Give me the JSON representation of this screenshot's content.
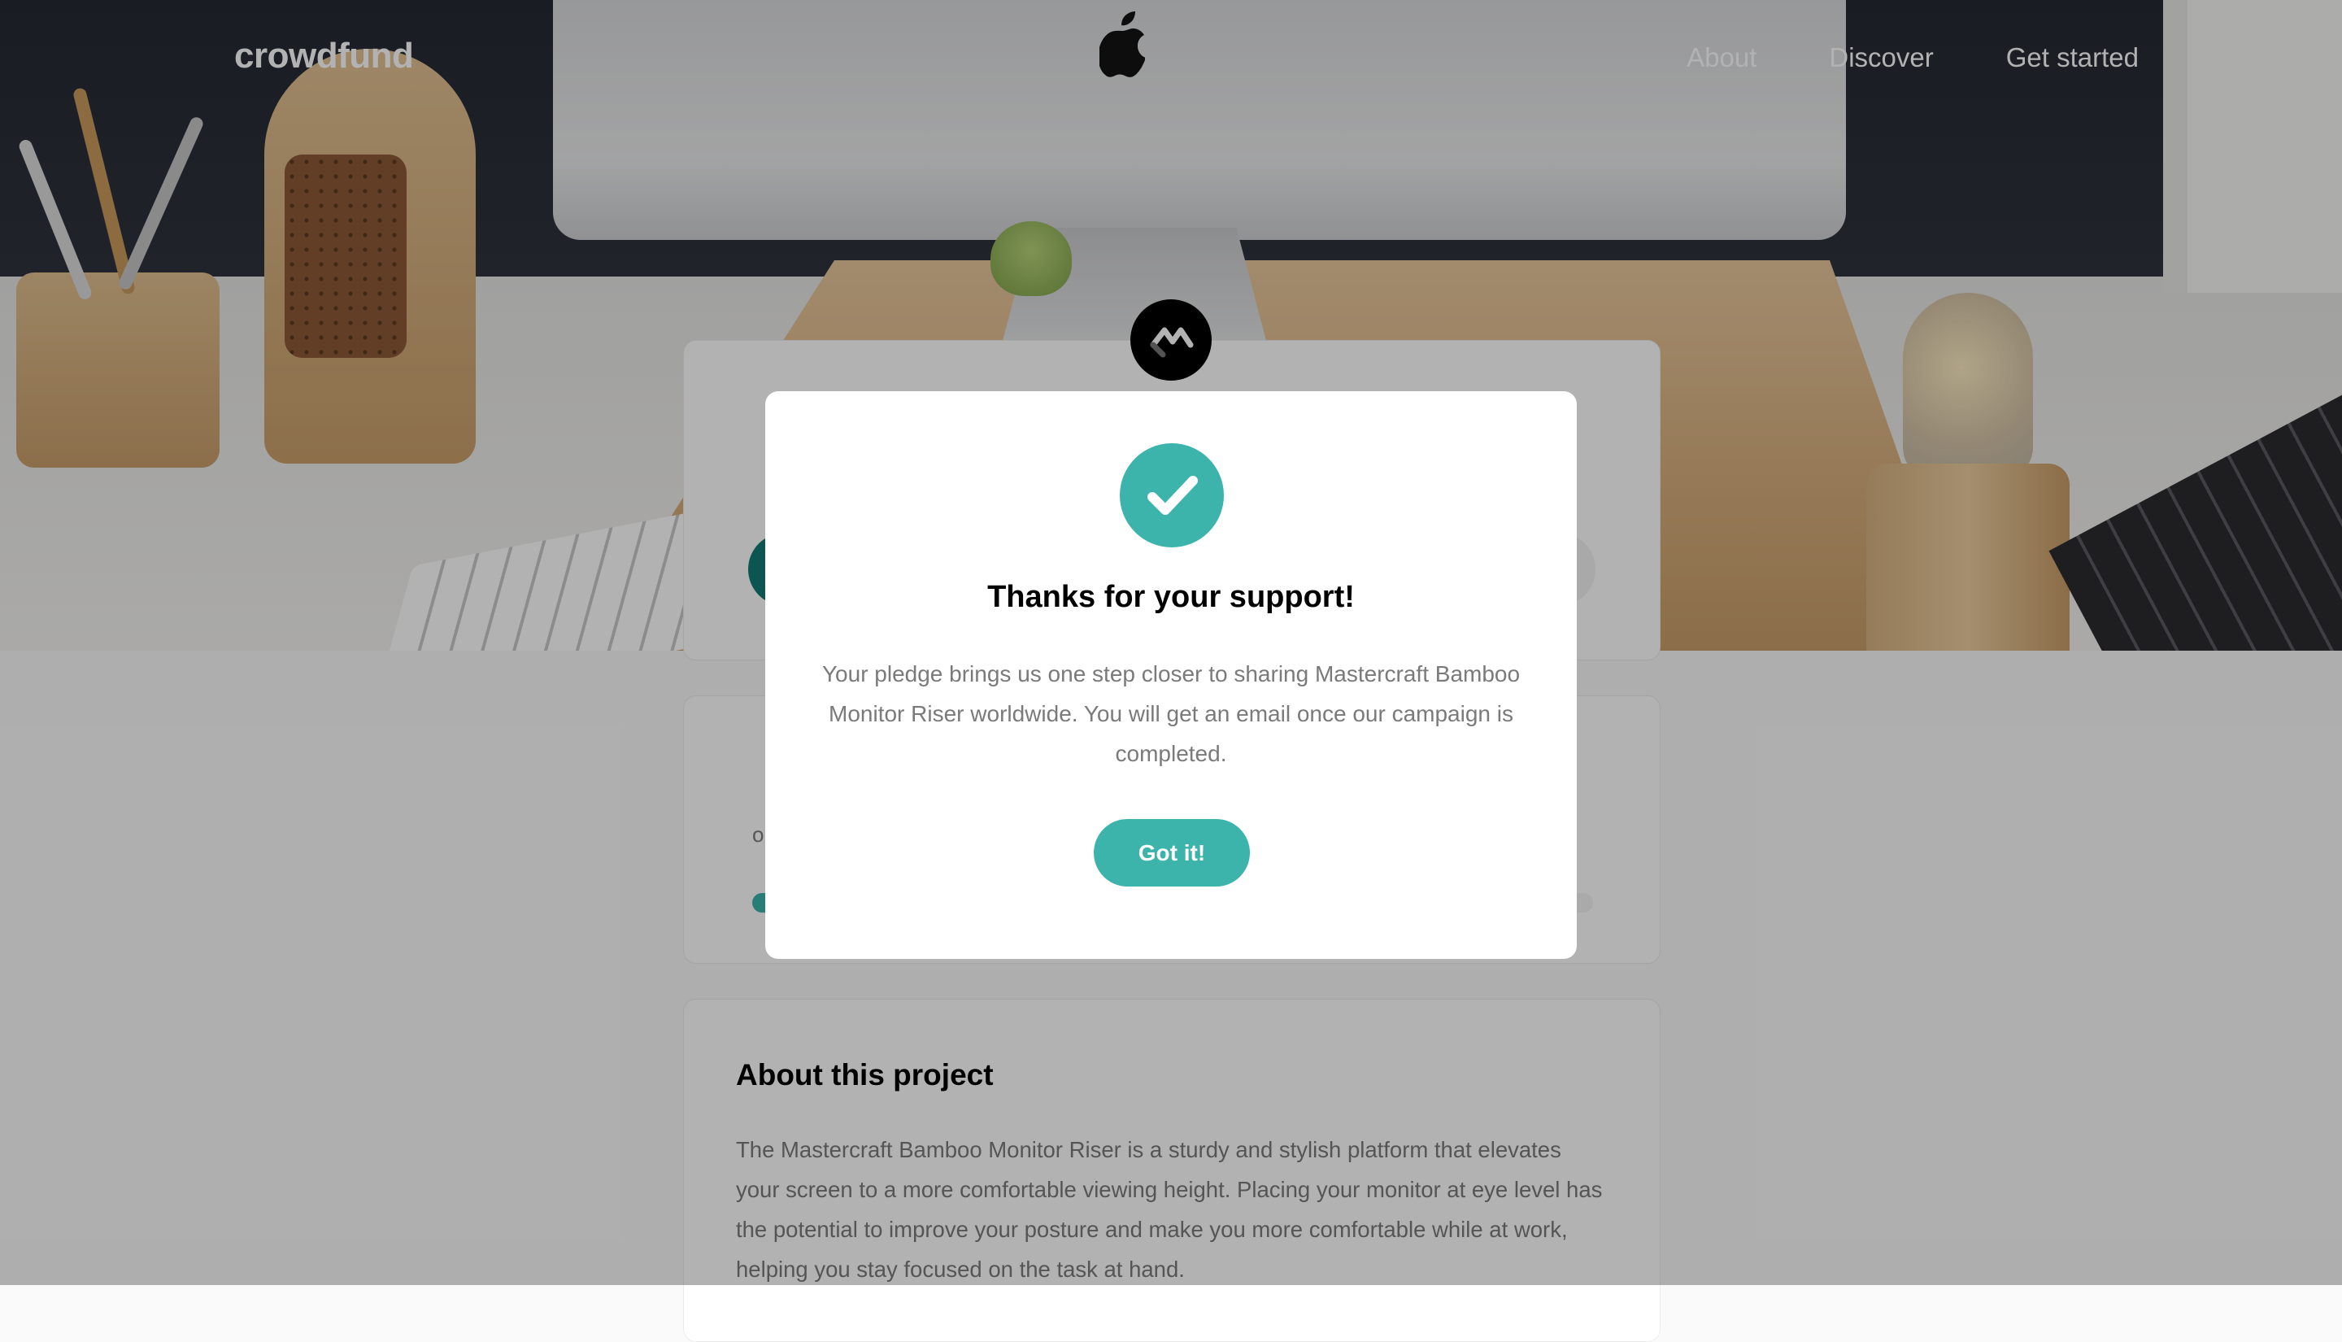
{
  "header": {
    "logo": "crowdfund",
    "nav": [
      "About",
      "Discover",
      "Get started"
    ]
  },
  "stats": {
    "fragment": "o",
    "progress_fraction": 0.89
  },
  "about": {
    "title": "About this project",
    "text": "The Mastercraft Bamboo Monitor Riser is a sturdy and stylish platform that elevates your screen to a more comfortable viewing height. Placing your monitor at eye level has the potential to improve your posture and make you more comfortable while at work, helping you stay focused on the task at hand."
  },
  "modal": {
    "title": "Thanks for your support!",
    "text": "Your pledge brings us one step closer to sharing Mastercraft Bamboo Monitor Riser worldwide. You will get an email once our campaign is completed.",
    "button_label": "Got it!",
    "icon": "check-icon"
  },
  "colors": {
    "accent": "#3cb3ab",
    "accent_dark": "#147a73",
    "overlay": "rgba(0,0,0,0.30)",
    "text_muted": "#7a7a7a"
  },
  "icons": {
    "brand": "mastercraft-logo-icon",
    "success": "check-icon",
    "hero_logo": "apple-icon"
  }
}
